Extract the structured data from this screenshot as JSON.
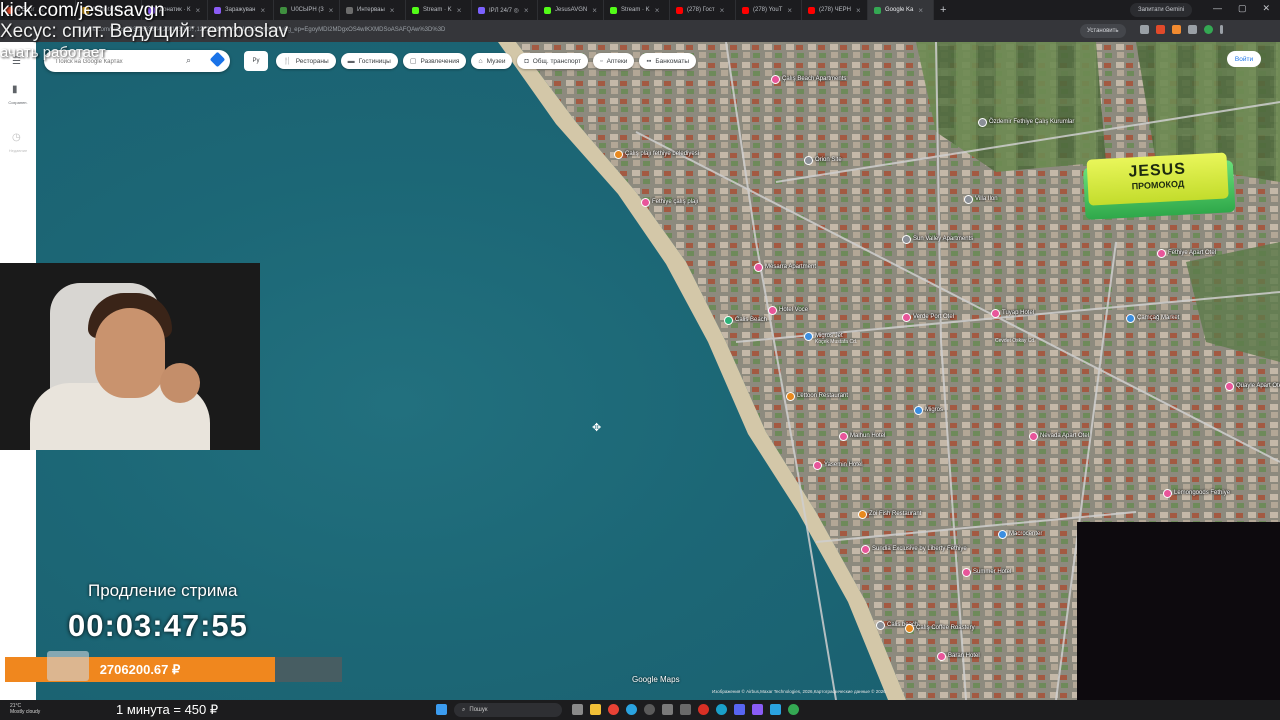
{
  "overlay": {
    "line1": "kick.com/jesusavgn",
    "line2": "Хесус: спит. Ведущий: remboslav",
    "line3": "ачать работает"
  },
  "browser": {
    "tabs": [
      {
        "label": "e Espr",
        "color": "#e24a2a"
      },
      {
        "label": "Monetizati",
        "color": "#f2b31b"
      },
      {
        "label": "Донатик · К",
        "color": "#8b5cf6"
      },
      {
        "label": "Заражуван",
        "color": "#8b5cf6"
      },
      {
        "label": "U0СЫРН (3",
        "color": "#3f8f3f"
      },
      {
        "label": "Интерваы",
        "color": "#6c6c6c"
      },
      {
        "label": "Stream · K",
        "color": "#53fc18"
      },
      {
        "label": "IPЛ 24/7 ◎",
        "color": "#7b61ff"
      },
      {
        "label": "JesusAVGN",
        "color": "#53fc18"
      },
      {
        "label": "Stream · K",
        "color": "#53fc18"
      },
      {
        "label": "(278) Гост",
        "color": "#ff0000"
      },
      {
        "label": "(278) YouT",
        "color": "#ff0000"
      },
      {
        "label": "(278) ЧЕРН",
        "color": "#ff0000"
      },
      {
        "label": "Google Ka",
        "color": "#34a853"
      }
    ],
    "gemini_label": "Запитати Gemini",
    "install_label": "Установить",
    "url": "google.com/maps/@36.663344,29.1030737,1222m/data=!3m1!1e3?entry=ttu&g_ep=EgoyMDI2MDgxOS4wIKXMDSoASAFQAw%3D%3D"
  },
  "map": {
    "search_placeholder": "Поиск на Google Картах",
    "lang_button": "Ру",
    "chips": [
      {
        "label": "Рестораны",
        "icon": "fork-knife-icon",
        "glyph": "🍴"
      },
      {
        "label": "Гостиницы",
        "icon": "bed-icon",
        "glyph": "▬"
      },
      {
        "label": "Развлечения",
        "icon": "ticket-icon",
        "glyph": "▢"
      },
      {
        "label": "Музеи",
        "icon": "museum-icon",
        "glyph": "⌂"
      },
      {
        "label": "Общ. транспорт",
        "icon": "bus-icon",
        "glyph": "◘"
      },
      {
        "label": "Аптеки",
        "icon": "pharmacy-icon",
        "glyph": "▫"
      },
      {
        "label": "Банкоматы",
        "icon": "atm-icon",
        "glyph": "▪▪"
      }
    ],
    "signin_label": "Войти",
    "rail": {
      "saved_label": "Сохранен.",
      "history_label": "Недавние"
    },
    "places": [
      {
        "name": "Çalış Beach Apartments",
        "color": "pink"
      },
      {
        "name": "Çalış plajı fethiye belediyesi",
        "color": "orange"
      },
      {
        "name": "Orion Site",
        "color": "gray"
      },
      {
        "name": "Özdemir Fethiye Çalış Kurumlar",
        "color": "gray"
      },
      {
        "name": "Fethiye çalış plajı",
        "color": "pink"
      },
      {
        "name": "Villa Ilon",
        "color": "gray"
      },
      {
        "name": "Sun Valley Apartments",
        "color": "gray"
      },
      {
        "name": "Fethiye Apart Otel",
        "color": "pink"
      },
      {
        "name": "Mesarra Apartment",
        "color": "pink"
      },
      {
        "name": "Calis Beach",
        "color": "green"
      },
      {
        "name": "Verde Port Otel",
        "color": "pink"
      },
      {
        "name": "Tuyap Hotel",
        "color": "pink"
      },
      {
        "name": "Çamçağ Market",
        "color": "blue"
      },
      {
        "name": "Hotel Voce",
        "color": "pink"
      },
      {
        "name": "Migros Jet",
        "color": "blue"
      },
      {
        "name": "Koçek Mustafa Cd.",
        "color": "none"
      },
      {
        "name": "Cevdet Oskay Cd.",
        "color": "none"
      },
      {
        "name": "Quayle Apart Otel",
        "color": "pink"
      },
      {
        "name": "Lettoon Restaurant",
        "color": "orange"
      },
      {
        "name": "Migros",
        "color": "blue"
      },
      {
        "name": "Nevada Apart Otel",
        "color": "pink"
      },
      {
        "name": "Malhun Hotel",
        "color": "pink"
      },
      {
        "name": "Yasemin Hotel",
        "color": "pink"
      },
      {
        "name": "Lemongoods Fethiye",
        "color": "pink"
      },
      {
        "name": "Zoi Fish Restaurant",
        "color": "orange"
      },
      {
        "name": "Macrocenter",
        "color": "blue"
      },
      {
        "name": "Sundia Exclusive by Liberty Fethiye",
        "color": "pink"
      },
      {
        "name": "Summer Hotel",
        "color": "pink"
      },
      {
        "name": "Calis beach",
        "color": "gray"
      },
      {
        "name": "Çalış Coffee Roastery",
        "color": "orange"
      },
      {
        "name": "Baran Hotel",
        "color": "pink"
      }
    ],
    "watermark": "Google Maps",
    "attribution": "Изображения © Airbus,Maxar Technologies, 2026,Картографические данные © 2026"
  },
  "stream": {
    "promo_line1": "JESUS",
    "promo_line2": "ПРОМОКОД",
    "extension_label": "Продление стрима",
    "timer": "00:03:47:55",
    "donation_total": "2706200.67 ₽"
  },
  "taskbar": {
    "weather_temp": "21°C",
    "weather_desc": "Mostly cloudy",
    "rate_text": "1 минута = 450 ₽",
    "search_label": "Пошук"
  }
}
